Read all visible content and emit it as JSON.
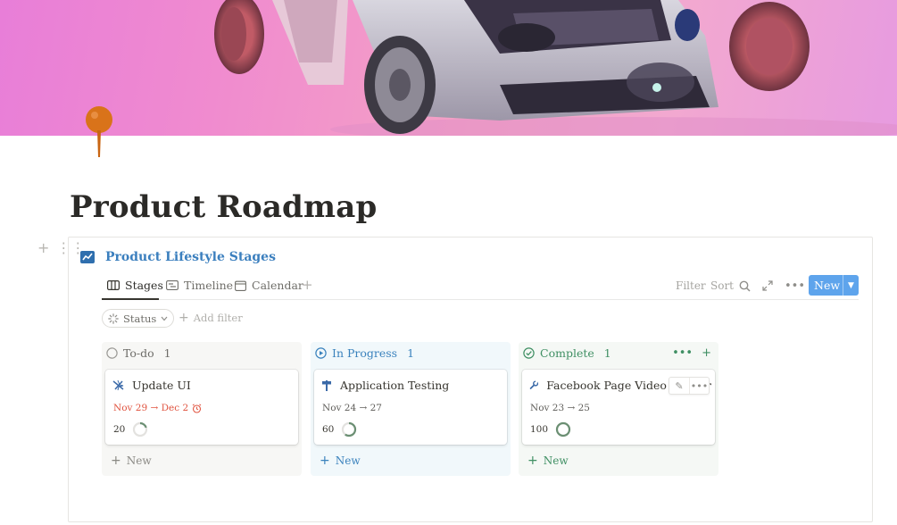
{
  "page": {
    "title": "Product Roadmap"
  },
  "database": {
    "title": "Product Lifestyle Stages",
    "views": [
      {
        "label": "Stages",
        "icon": "board-icon",
        "active": true
      },
      {
        "label": "Timeline",
        "icon": "timeline-icon",
        "active": false
      },
      {
        "label": "Calendar",
        "icon": "calendar-icon",
        "active": false
      }
    ],
    "toolbar": {
      "filter_label": "Filter",
      "sort_label": "Sort",
      "new_label": "New"
    },
    "filters": {
      "status_label": "Status",
      "add_filter_label": "Add filter"
    },
    "columns": [
      {
        "name": "To-do",
        "count": "1",
        "color": "#6d6c68",
        "new_label": "New",
        "card": {
          "title": "Update UI",
          "icon": "flight-icon",
          "dates": "Nov 29 → Dec 2",
          "overdue": true,
          "progress": "20",
          "progress_value": 0.2
        }
      },
      {
        "name": "In Progress",
        "count": "1",
        "color": "#3a82bd",
        "new_label": "New",
        "card": {
          "title": "Application Testing",
          "icon": "signpost-icon",
          "dates": "Nov 24 → 27",
          "overdue": false,
          "progress": "60",
          "progress_value": 0.6
        }
      },
      {
        "name": "Complete",
        "count": "1",
        "color": "#3f8f63",
        "new_label": "New",
        "card": {
          "title": "Facebook Page Video Banner",
          "icon": "wrench-icon",
          "dates": "Nov 23 → 25",
          "overdue": false,
          "progress": "100",
          "progress_value": 1.0
        }
      }
    ]
  },
  "colors": {
    "accent": "#5ea4ec",
    "overdue": "#e0533f",
    "progress_ring": "#6b8f73"
  }
}
